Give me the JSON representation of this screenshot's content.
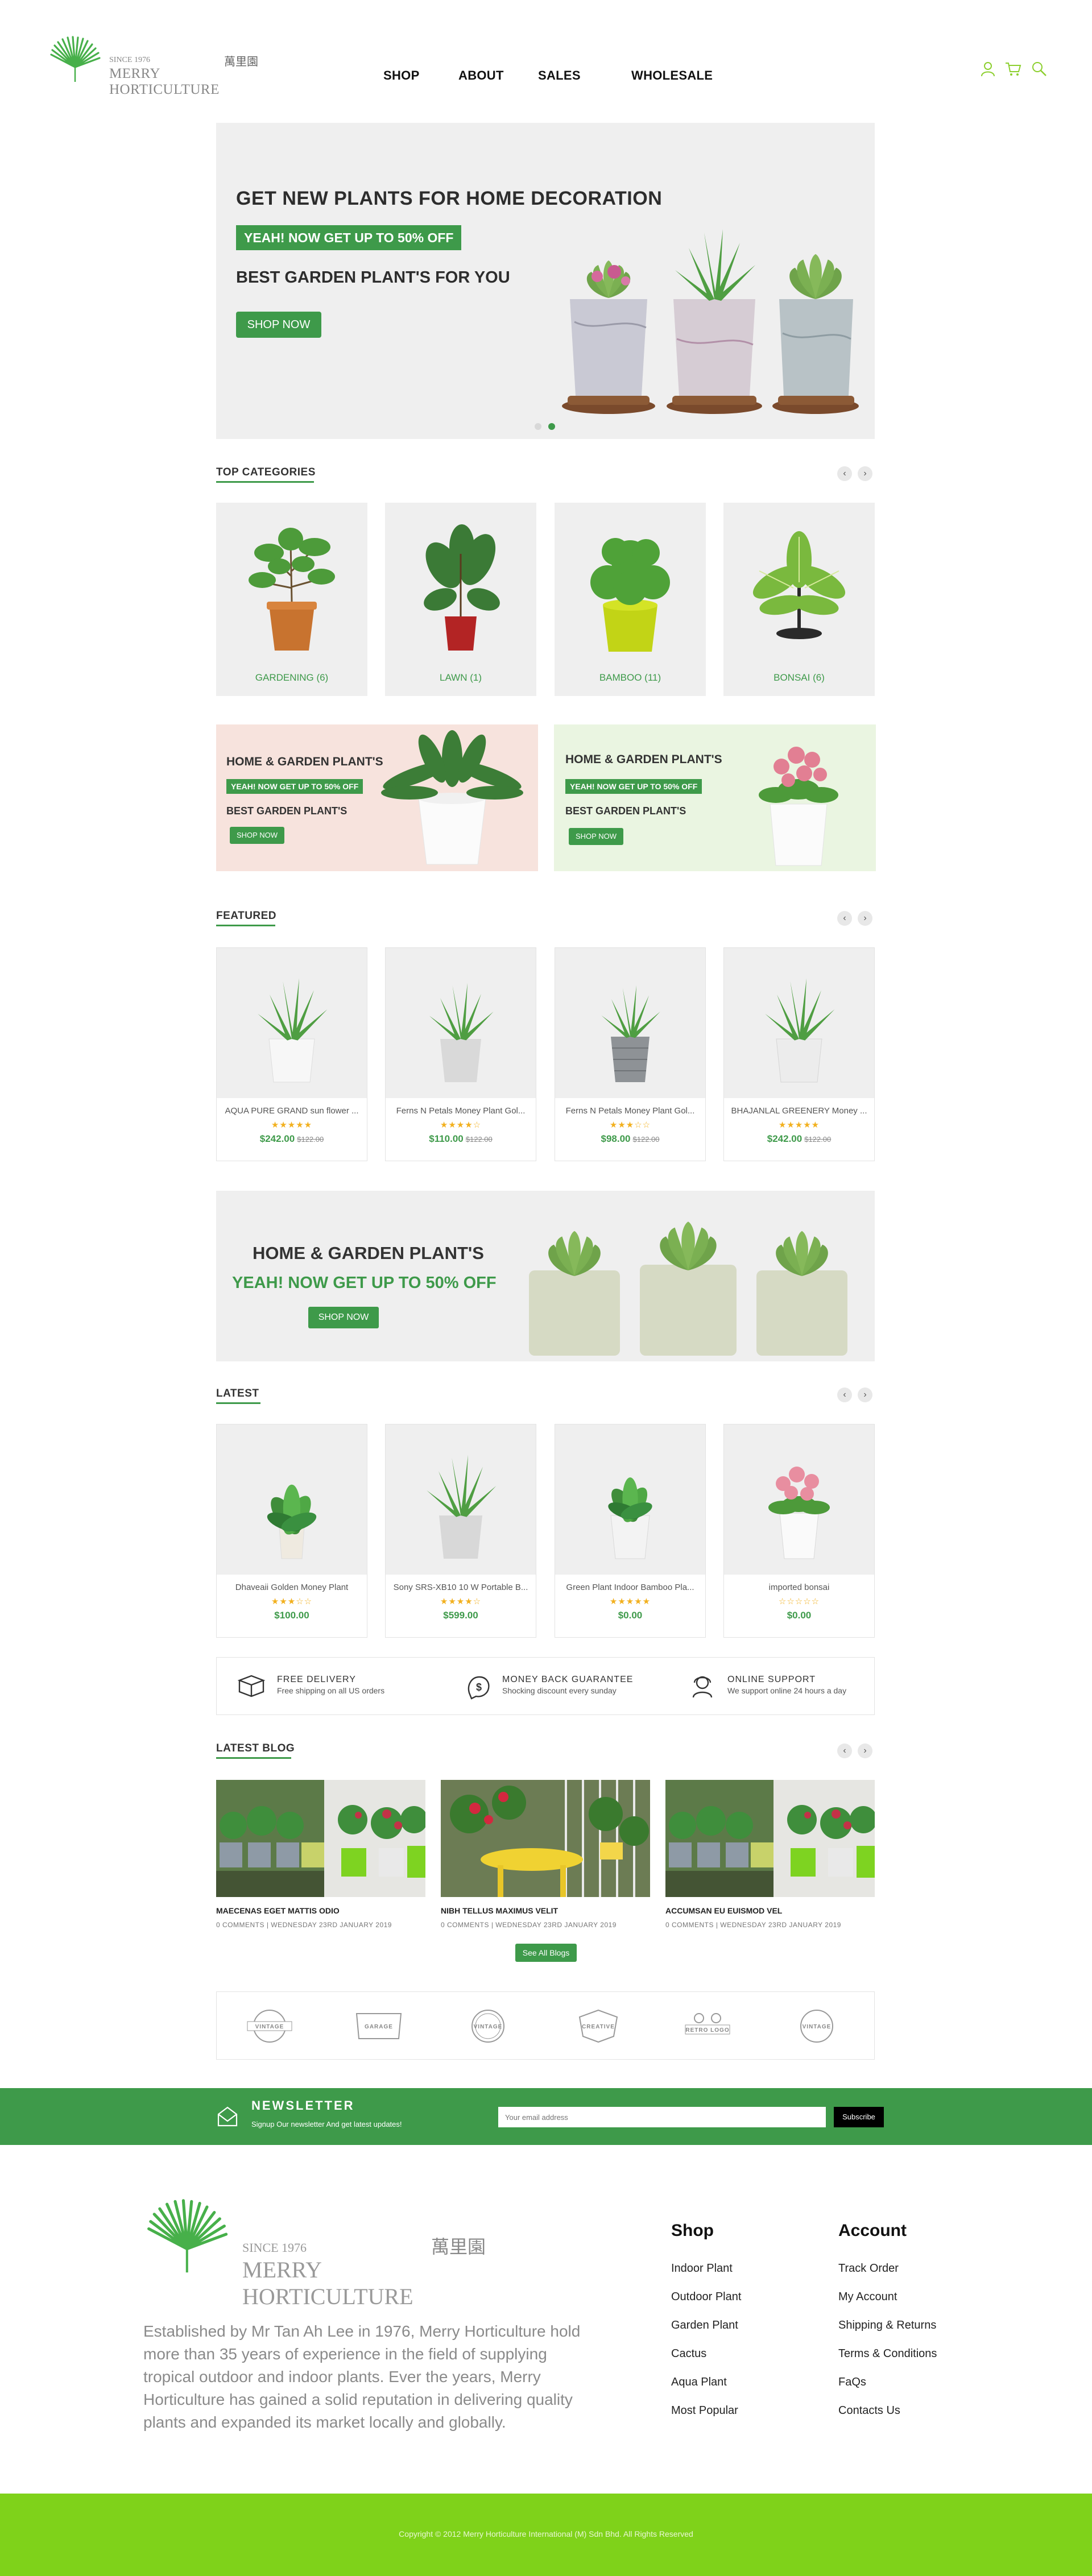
{
  "colors": {
    "accent": "#3e9a4a",
    "light_green": "#7fd21a",
    "panel_gray": "#efefef",
    "pink_panel": "#f7e3dd",
    "mint_panel": "#eaf5e1"
  },
  "header": {
    "logo": {
      "since": "SINCE 1976",
      "chinese": "萬里園",
      "name": "MERRY HORTICULTURE"
    },
    "nav": [
      "SHOP",
      "ABOUT",
      "SALES",
      "WHOLESALE"
    ],
    "icons": [
      "user-icon",
      "cart-icon",
      "search-icon"
    ]
  },
  "hero": {
    "title": "GET NEW PLANTS FOR HOME DECORATION",
    "badge": "YEAH! NOW GET UP TO 50% OFF",
    "subtitle": "BEST GARDEN PLANT'S  FOR YOU",
    "button": "SHOP NOW",
    "slides": 2,
    "active_slide": 2
  },
  "categories": {
    "title": "TOP CATEGORIES",
    "items": [
      {
        "label": "GARDENING (6)"
      },
      {
        "label": "LAWN (1)"
      },
      {
        "label": "BAMBOO (11)"
      },
      {
        "label": "BONSAI (6)"
      }
    ]
  },
  "promos": [
    {
      "title": "HOME & GARDEN PLANT'S",
      "badge": "YEAH! NOW GET UP TO 50% OFF",
      "subtitle": "BEST GARDEN PLANT'S",
      "button": "SHOP NOW"
    },
    {
      "title": "HOME & GARDEN PLANT'S",
      "badge": "YEAH! NOW GET UP TO 50% OFF",
      "subtitle": "BEST GARDEN PLANT'S",
      "button": "SHOP NOW"
    }
  ],
  "featured": {
    "title": "FEATURED",
    "items": [
      {
        "name": "AQUA PURE GRAND sun flower ...",
        "stars": "★★★★★",
        "price": "$242.00",
        "old_price": "$122.00"
      },
      {
        "name": "Ferns N Petals Money Plant Gol...",
        "stars": "★★★★☆",
        "price": "$110.00",
        "old_price": "$122.00"
      },
      {
        "name": "Ferns N Petals Money Plant Gol...",
        "stars": "★★★☆☆",
        "price": "$98.00",
        "old_price": "$122.00"
      },
      {
        "name": "BHAJANLAL GREENERY Money ...",
        "stars": "★★★★★",
        "price": "$242.00",
        "old_price": "$122.00"
      }
    ]
  },
  "wide_banner": {
    "title": "HOME & GARDEN PLANT'S",
    "subtitle": "YEAH! NOW GET UP TO 50% OFF",
    "button": "SHOP NOW"
  },
  "latest": {
    "title": "LATEST",
    "items": [
      {
        "name": "Dhaveaii Golden Money Plant",
        "stars": "★★★☆☆",
        "price": "$100.00"
      },
      {
        "name": "Sony SRS-XB10 10 W Portable B...",
        "stars": "★★★★☆",
        "price": "$599.00"
      },
      {
        "name": "Green Plant Indoor Bamboo Pla...",
        "stars": "★★★★★",
        "price": "$0.00"
      },
      {
        "name": "imported bonsai",
        "stars": "☆☆☆☆☆",
        "price": "$0.00"
      }
    ]
  },
  "features": [
    {
      "icon": "delivery-box-icon",
      "title": "FREE DELIVERY",
      "desc": "Free shipping on all US orders"
    },
    {
      "icon": "money-back-icon",
      "title": "MONEY BACK GUARANTEE",
      "desc": "Shocking discount every sunday"
    },
    {
      "icon": "support-agent-icon",
      "title": "ONLINE SUPPORT",
      "desc": "We support online 24 hours a day"
    }
  ],
  "blog": {
    "title": "LATEST BLOG",
    "posts": [
      {
        "title": "MAECENAS EGET MATTIS ODIO",
        "meta": "0 COMMENTS | WEDNESDAY 23RD JANUARY 2019"
      },
      {
        "title": "NIBH TELLUS MAXIMUS VELIT",
        "meta": "0 COMMENTS | WEDNESDAY 23RD JANUARY 2019"
      },
      {
        "title": "ACCUMSAN EU EUISMOD VEL",
        "meta": "0 COMMENTS | WEDNESDAY 23RD JANUARY 2019"
      }
    ],
    "see_all": "See All Blogs"
  },
  "brands": [
    "VINTAGE",
    "GARAGE",
    "VINTAGE",
    "CREATIVE",
    "RETRO LOGO",
    "VINTAGE"
  ],
  "newsletter": {
    "title": "NEWSLETTER",
    "desc": "Signup Our newsletter And get latest updates!",
    "placeholder": "Your email address",
    "button": "Subscribe"
  },
  "footer": {
    "about": "Established by Mr Tan Ah Lee in 1976, Merry Horticulture hold more than 35 years of experience in the field of supplying tropical outdoor and indoor plants. Ever the years, Merry Horticulture has gained a solid reputation in delivering quality plants and expanded its market locally and globally.",
    "shop": {
      "title": "Shop",
      "links": [
        "Indoor Plant",
        "Outdoor Plant",
        "Garden Plant",
        "Cactus",
        "Aqua Plant",
        "Most Popular"
      ]
    },
    "account": {
      "title": "Account",
      "links": [
        "Track Order",
        "My Account",
        "Shipping & Returns",
        "Terms & Conditions",
        "FaQs",
        "Contacts Us"
      ]
    },
    "copyright": "Copyright © 2012 Merry Horticulture International (M) Sdn Bhd. All Rights Reserved"
  }
}
